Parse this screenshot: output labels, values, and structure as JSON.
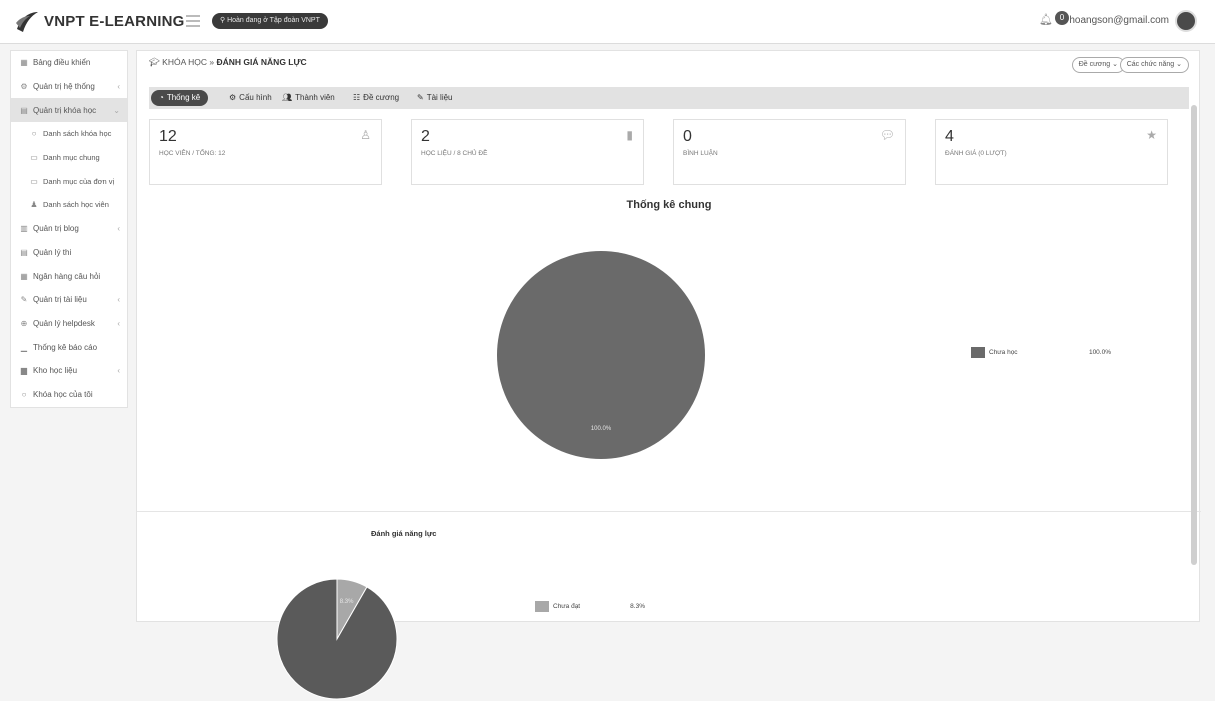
{
  "app": {
    "brand": "VNPT E-LEARNING",
    "badge": "Hoàn đang ở Tập đoàn VNPT",
    "notifications": "0",
    "email": "hoangson@gmail.com"
  },
  "sidebar": {
    "items": [
      {
        "label": "Bảng điều khiển",
        "icon": "dashboard-icon"
      },
      {
        "label": "Quản trị hệ thống",
        "icon": "settings-icon"
      },
      {
        "label": "Quản trị khóa học",
        "icon": "course-icon"
      },
      {
        "label": "Danh sách khóa học",
        "icon": "circle-icon"
      },
      {
        "label": "Danh mục chung",
        "icon": "folder-icon"
      },
      {
        "label": "Danh mục của đơn vị",
        "icon": "folder-icon"
      },
      {
        "label": "Danh sách học viên",
        "icon": "user-icon"
      },
      {
        "label": "Quản trị blog",
        "icon": "blog-icon"
      },
      {
        "label": "Quản lý thi",
        "icon": "exam-icon"
      },
      {
        "label": "Ngân hàng câu hỏi",
        "icon": "bank-icon"
      },
      {
        "label": "Quản trị tài liệu",
        "icon": "document-icon"
      },
      {
        "label": "Quản lý helpdesk",
        "icon": "helpdesk-icon"
      },
      {
        "label": "Thống kê báo cáo",
        "icon": "chart-icon"
      },
      {
        "label": "Kho học liệu",
        "icon": "library-icon"
      },
      {
        "label": "Khóa học của tôi",
        "icon": "circle-icon"
      }
    ]
  },
  "header": {
    "section": "KHÓA HỌC",
    "separator": "»",
    "current": "ĐÁNH GIÁ NĂNG LỰC",
    "btn_outline": "Đề cương",
    "btn_functions": "Các chức năng"
  },
  "tabs": [
    {
      "label": "Thống kê"
    },
    {
      "label": "Cấu hình"
    },
    {
      "label": "Thành viên"
    },
    {
      "label": "Đề cương"
    },
    {
      "label": "Tài liệu"
    }
  ],
  "stats": [
    {
      "value": "12",
      "label": "HỌC VIÊN / TỔNG: 12"
    },
    {
      "value": "2",
      "label": "HỌC LIỆU / 8 CHỦ ĐỀ"
    },
    {
      "value": "0",
      "label": "BÌNH LUẬN"
    },
    {
      "value": "4",
      "label": "ĐÁNH GIÁ (0 LƯỢT)"
    }
  ],
  "chart_data": [
    {
      "type": "pie",
      "title": "Thống kê chung",
      "slices": [
        {
          "name": "Chưa học",
          "value": 100.0,
          "label": "100.0%",
          "legend": "100.0%",
          "color": "#6a6a6a"
        }
      ]
    },
    {
      "type": "pie",
      "title": "Đánh giá năng lực",
      "slices": [
        {
          "name": "Chưa đạt",
          "value": 8.3,
          "label": "8.3%",
          "legend": "8.3%",
          "color": "#a8a8a8"
        },
        {
          "name": "",
          "value": 91.7,
          "label": "",
          "legend": "",
          "color": "#5a5a5a"
        }
      ]
    }
  ]
}
